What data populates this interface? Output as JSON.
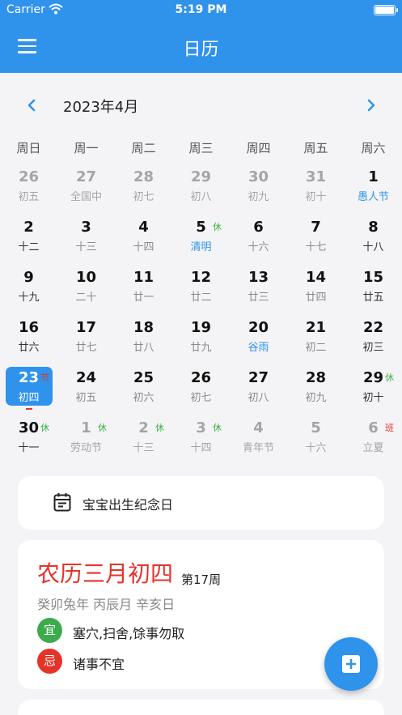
{
  "status_bar": {
    "carrier": "Carrier",
    "time": "5:19 PM"
  },
  "app": {
    "title": "日历"
  },
  "month_nav": {
    "label": "2023年4月"
  },
  "weekdays": [
    "周日",
    "周一",
    "周二",
    "周三",
    "周四",
    "周五",
    "周六"
  ],
  "calendar_days": [
    {
      "day": "26",
      "lunar": "初五",
      "muted": true
    },
    {
      "day": "27",
      "lunar": "全国中",
      "muted": true
    },
    {
      "day": "28",
      "lunar": "初七",
      "muted": true
    },
    {
      "day": "29",
      "lunar": "初八",
      "muted": true
    },
    {
      "day": "30",
      "lunar": "初九",
      "muted": true
    },
    {
      "day": "31",
      "lunar": "初十",
      "muted": true
    },
    {
      "day": "1",
      "lunar": "愚人节",
      "festival": true
    },
    {
      "day": "2",
      "lunar": "十二"
    },
    {
      "day": "3",
      "lunar": "十三",
      "dim_lunar": true
    },
    {
      "day": "4",
      "lunar": "十四",
      "dim_lunar": true
    },
    {
      "day": "5",
      "lunar": "清明",
      "festival": true,
      "badge": "休",
      "badge_color": "green"
    },
    {
      "day": "6",
      "lunar": "十六",
      "dim_lunar": true
    },
    {
      "day": "7",
      "lunar": "十七",
      "dim_lunar": true
    },
    {
      "day": "8",
      "lunar": "十八"
    },
    {
      "day": "9",
      "lunar": "十九"
    },
    {
      "day": "10",
      "lunar": "二十",
      "dim_lunar": true
    },
    {
      "day": "11",
      "lunar": "廿一",
      "dim_lunar": true
    },
    {
      "day": "12",
      "lunar": "廿二",
      "dim_lunar": true
    },
    {
      "day": "13",
      "lunar": "廿三",
      "dim_lunar": true
    },
    {
      "day": "14",
      "lunar": "廿四",
      "dim_lunar": true
    },
    {
      "day": "15",
      "lunar": "廿五"
    },
    {
      "day": "16",
      "lunar": "廿六"
    },
    {
      "day": "17",
      "lunar": "廿七",
      "dim_lunar": true
    },
    {
      "day": "18",
      "lunar": "廿八",
      "dim_lunar": true
    },
    {
      "day": "19",
      "lunar": "廿九",
      "dim_lunar": true
    },
    {
      "day": "20",
      "lunar": "谷雨",
      "festival": true
    },
    {
      "day": "21",
      "lunar": "初二",
      "dim_lunar": true
    },
    {
      "day": "22",
      "lunar": "初三"
    },
    {
      "day": "23",
      "lunar": "初四",
      "today": true,
      "badge": "节",
      "badge_color": "red"
    },
    {
      "day": "24",
      "lunar": "初五",
      "dim_lunar": true
    },
    {
      "day": "25",
      "lunar": "初六",
      "dim_lunar": true
    },
    {
      "day": "26",
      "lunar": "初七",
      "dim_lunar": true
    },
    {
      "day": "27",
      "lunar": "初八",
      "dim_lunar": true
    },
    {
      "day": "28",
      "lunar": "初九",
      "dim_lunar": true
    },
    {
      "day": "29",
      "lunar": "初十",
      "badge": "休",
      "badge_color": "green"
    },
    {
      "day": "30",
      "lunar": "十一",
      "badge": "休",
      "badge_color": "green"
    },
    {
      "day": "1",
      "lunar": "劳动节",
      "muted": true,
      "badge": "休",
      "badge_color": "green"
    },
    {
      "day": "2",
      "lunar": "十三",
      "muted": true,
      "badge": "休",
      "badge_color": "green"
    },
    {
      "day": "3",
      "lunar": "十四",
      "muted": true,
      "badge": "休",
      "badge_color": "green"
    },
    {
      "day": "4",
      "lunar": "青年节",
      "muted": true
    },
    {
      "day": "5",
      "lunar": "十六",
      "muted": true
    },
    {
      "day": "6",
      "lunar": "立夏",
      "muted": true,
      "badge": "班",
      "badge_color": "red"
    }
  ],
  "anniversary": {
    "label": "宝宝出生纪念日"
  },
  "almanac": {
    "lunar_date": "农历三月初四",
    "week": "第17周",
    "ganzhi": "癸卯兔年 丙辰月 辛亥日",
    "yi_label": "宜",
    "yi_text": "塞穴,扫舍,馀事勿取",
    "ji_label": "忌",
    "ji_text": "诸事不宜"
  },
  "colors": {
    "primary": "#2f93ec",
    "red": "#e5332a",
    "green": "#3cab4c"
  }
}
